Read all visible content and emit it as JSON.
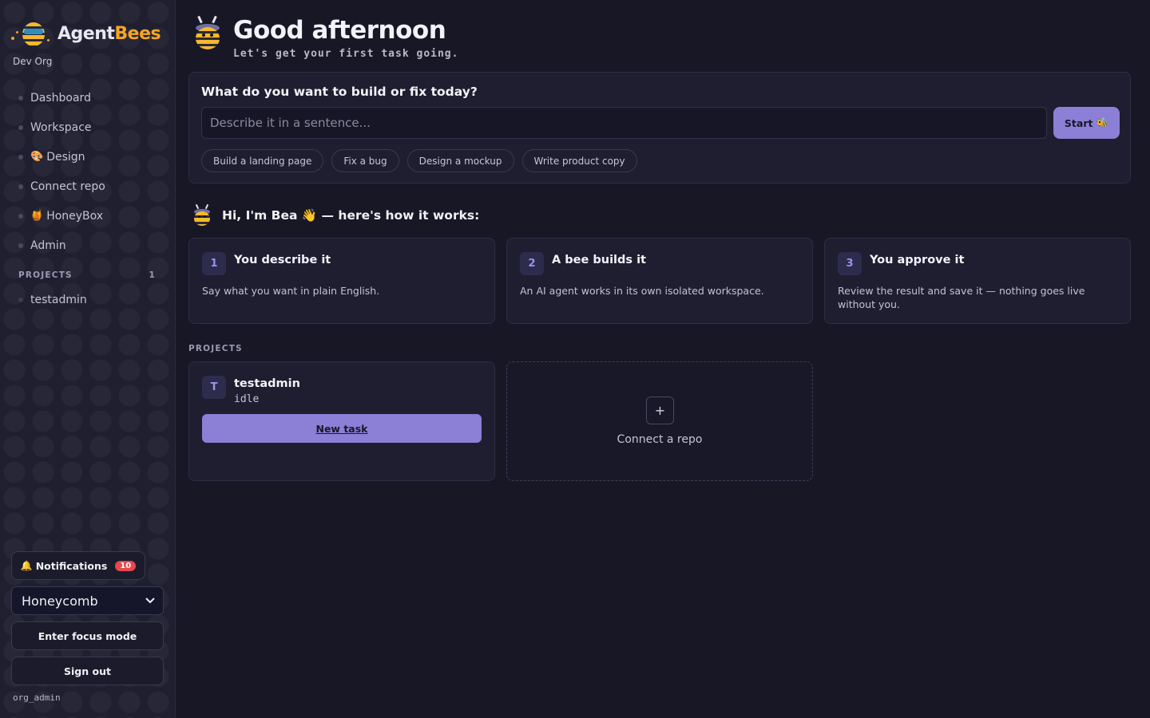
{
  "app": {
    "brand_a": "Agent",
    "brand_b": "Bees",
    "org": "Dev Org"
  },
  "sidebar": {
    "items": [
      {
        "label": "Dashboard",
        "emoji": ""
      },
      {
        "label": "Workspace",
        "emoji": ""
      },
      {
        "label": "Design",
        "emoji": "🎨"
      },
      {
        "label": "Connect repo",
        "emoji": ""
      },
      {
        "label": "HoneyBox",
        "emoji": "🍯"
      },
      {
        "label": "Admin",
        "emoji": ""
      }
    ],
    "projects_heading": "PROJECTS",
    "projects_count": "1",
    "projects": [
      "testadmin"
    ],
    "notifications_icon": "🔔",
    "notifications_label": "Notifications",
    "notifications_count": "10",
    "theme_value": "Honeycomb",
    "focus_label": "Enter focus mode",
    "signout_label": "Sign out",
    "role": "org_admin"
  },
  "header": {
    "title": "Good afternoon",
    "subtitle": "Let's get your first task going."
  },
  "prompt": {
    "question": "What do you want to build or fix today?",
    "placeholder": "Describe it in a sentence...",
    "start_label": "Start",
    "start_icon": "🐝",
    "chips": [
      "Build a landing page",
      "Fix a bug",
      "Design a mockup",
      "Write product copy"
    ]
  },
  "intro": {
    "text": "Hi, I'm Bea 👋 — here's how it works:"
  },
  "steps": [
    {
      "num": "1",
      "title": "You describe it",
      "desc": "Say what you want in plain English."
    },
    {
      "num": "2",
      "title": "A bee builds it",
      "desc": "An AI agent works in its own isolated workspace."
    },
    {
      "num": "3",
      "title": "You approve it",
      "desc": "Review the result and save it — nothing goes live without you."
    }
  ],
  "projects": {
    "label": "PROJECTS",
    "card": {
      "initial": "T",
      "name": "testadmin",
      "status": "idle",
      "action": "New task"
    },
    "connect": {
      "icon": "+",
      "label": "Connect a repo"
    }
  },
  "colors": {
    "accent": "#8b7fd6",
    "brand": "#f5a524",
    "badge": "#e5484d"
  }
}
